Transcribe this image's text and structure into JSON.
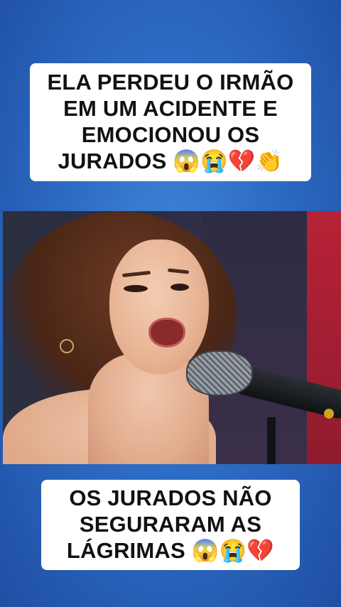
{
  "top_caption": {
    "line1": "ELA PERDEU O IRMÃO",
    "line2": "EM UM ACIDENTE E",
    "line3": "EMOCIONOU OS",
    "line4": "JURADOS 😱😭💔👏"
  },
  "bottom_caption": {
    "line1": "OS JURADOS NÃO",
    "line2": "SEGURARAM AS",
    "line3": "LÁGRIMAS 😱😭💔"
  },
  "colors": {
    "background": "#2d6bc4",
    "caption_bg": "#ffffff",
    "caption_text": "#111111",
    "stage_red": "#b82236"
  }
}
